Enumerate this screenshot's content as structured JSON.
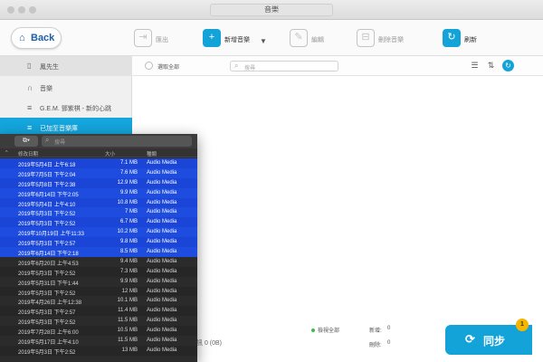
{
  "window": {
    "title": "音樂"
  },
  "toolbar": {
    "back_label": "Back",
    "items": [
      {
        "label": "匯出",
        "icon": "export-icon"
      },
      {
        "label": "新增音樂",
        "icon": "add-music-icon"
      },
      {
        "label": "編輯",
        "icon": "edit-icon"
      },
      {
        "label": "刪除音樂",
        "icon": "delete-icon"
      },
      {
        "label": "刷新",
        "icon": "refresh-icon"
      }
    ]
  },
  "sidebar": {
    "device": "鳳先生",
    "items": [
      {
        "label": "音樂",
        "icon": "headphones-icon"
      },
      {
        "label": "G.E.M. 鄧紫棋 - 新的心跳",
        "icon": "playlist-icon"
      },
      {
        "label": "已加至音樂庫",
        "icon": "playlist-icon"
      }
    ]
  },
  "main": {
    "select_all": "選取全部",
    "search_placeholder": "搜尋",
    "footer": {
      "selected_label": "檢視全部",
      "added_label": "新增:",
      "added_value": "0",
      "removed_label": "刪除:",
      "removed_value": "0",
      "storage": "音訊 0 (0B)"
    },
    "sync_label": "同步",
    "sync_badge": "1"
  },
  "finder": {
    "search_placeholder": "搜尋",
    "columns": {
      "date": "修改日期",
      "size": "大小",
      "kind": "種類"
    },
    "rows": [
      {
        "date": "2019年5月4日 上午6:18",
        "size": "7.1 MB",
        "kind": "Audio Media",
        "selected": true
      },
      {
        "date": "2019年7月5日 下午2:04",
        "size": "7.6 MB",
        "kind": "Audio Media",
        "selected": true
      },
      {
        "date": "2019年5月8日 下午2:38",
        "size": "12.9 MB",
        "kind": "Audio Media",
        "selected": true
      },
      {
        "date": "2019年6月14日 下午2:05",
        "size": "9.9 MB",
        "kind": "Audio Media",
        "selected": true
      },
      {
        "date": "2019年5月4日 上午4:10",
        "size": "10.8 MB",
        "kind": "Audio Media",
        "selected": true
      },
      {
        "date": "2019年5月3日 下午2:52",
        "size": "7 MB",
        "kind": "Audio Media",
        "selected": true
      },
      {
        "date": "2019年5月3日 下午2:52",
        "size": "6.7 MB",
        "kind": "Audio Media",
        "selected": true
      },
      {
        "date": "2019年10月19日 上午11:33",
        "size": "10.2 MB",
        "kind": "Audio Media",
        "selected": true
      },
      {
        "date": "2019年5月3日 下午2:57",
        "size": "9.8 MB",
        "kind": "Audio Media",
        "selected": true
      },
      {
        "date": "2019年6月14日 下午2:18",
        "size": "8.5 MB",
        "kind": "Audio Media",
        "selected": true
      },
      {
        "date": "2019年6月20日 上午4:53",
        "size": "9.4 MB",
        "kind": "Audio Media",
        "selected": false
      },
      {
        "date": "2019年5月3日 下午2:52",
        "size": "7.3 MB",
        "kind": "Audio Media",
        "selected": false
      },
      {
        "date": "2019年5月31日 下午1:44",
        "size": "9.9 MB",
        "kind": "Audio Media",
        "selected": false
      },
      {
        "date": "2019年5月3日 下午2:52",
        "size": "12 MB",
        "kind": "Audio Media",
        "selected": false
      },
      {
        "date": "2019年4月26日 上午12:38",
        "size": "10.1 MB",
        "kind": "Audio Media",
        "selected": false
      },
      {
        "date": "2019年5月3日 下午2:57",
        "size": "11.4 MB",
        "kind": "Audio Media",
        "selected": false
      },
      {
        "date": "2019年5月3日 下午2:52",
        "size": "11.5 MB",
        "kind": "Audio Media",
        "selected": false
      },
      {
        "date": "2019年7月28日 上午6:00",
        "size": "10.5 MB",
        "kind": "Audio Media",
        "selected": false
      },
      {
        "date": "2019年5月17日 上午4:10",
        "size": "11.5 MB",
        "kind": "Audio Media",
        "selected": false
      },
      {
        "date": "2019年5月3日 下午2:52",
        "size": "13 MB",
        "kind": "Audio Media",
        "selected": false
      }
    ]
  },
  "colors": {
    "accent": "#13a3d8",
    "selection": "#1a45d6",
    "badge": "#f7b500"
  }
}
